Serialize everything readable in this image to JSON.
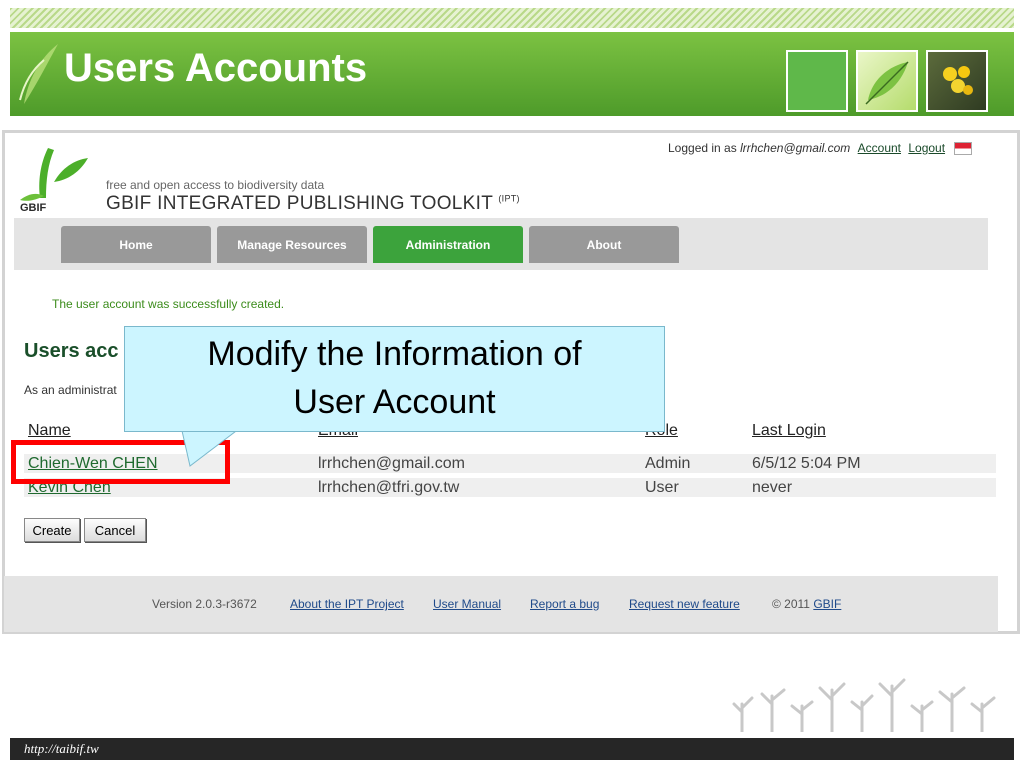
{
  "slide": {
    "title": "Users Accounts",
    "url": "http://taibif.tw"
  },
  "colors": {
    "title_green": "#5aaa30",
    "active_tab": "#3ca33c",
    "callout_fill": "#ccf5ff",
    "highlight_red": "#ff0000"
  },
  "header": {
    "logged_in_prefix": "Logged in as",
    "user_email": "lrrhchen@gmail.com",
    "account_link": "Account",
    "logout_link": "Logout",
    "logo_text": "GBIF",
    "tagline": "free and open access to biodiversity data",
    "toolkit_name": "GBIF INTEGRATED PUBLISHING TOOLKIT",
    "toolkit_abbr": "(IPT)"
  },
  "nav": {
    "tabs": [
      {
        "label": "Home",
        "active": false
      },
      {
        "label": "Manage Resources",
        "active": false
      },
      {
        "label": "Administration",
        "active": true
      },
      {
        "label": "About",
        "active": false
      }
    ]
  },
  "main": {
    "success_message": "The user account was successfully created.",
    "section_title": "Users acc",
    "description": "As an administrat",
    "columns": [
      "Name",
      "Email",
      "Role",
      "Last Login"
    ],
    "rows": [
      {
        "name": "Chien-Wen CHEN",
        "email": "lrrhchen@gmail.com",
        "role": "Admin",
        "last_login": "6/5/12 5:04 PM"
      },
      {
        "name": "Kevin Chen",
        "email": "lrrhchen@tfri.gov.tw",
        "role": "User",
        "last_login": "never"
      }
    ],
    "create_button": "Create",
    "cancel_button": "Cancel"
  },
  "callout": {
    "line1": "Modify the Information of",
    "line2": "User Account"
  },
  "footer": {
    "version": "Version 2.0.3-r3672",
    "links": [
      "About the IPT Project",
      "User Manual",
      "Report a bug",
      "Request new feature"
    ],
    "copyright": "© 2011",
    "gbif_link": "GBIF"
  }
}
